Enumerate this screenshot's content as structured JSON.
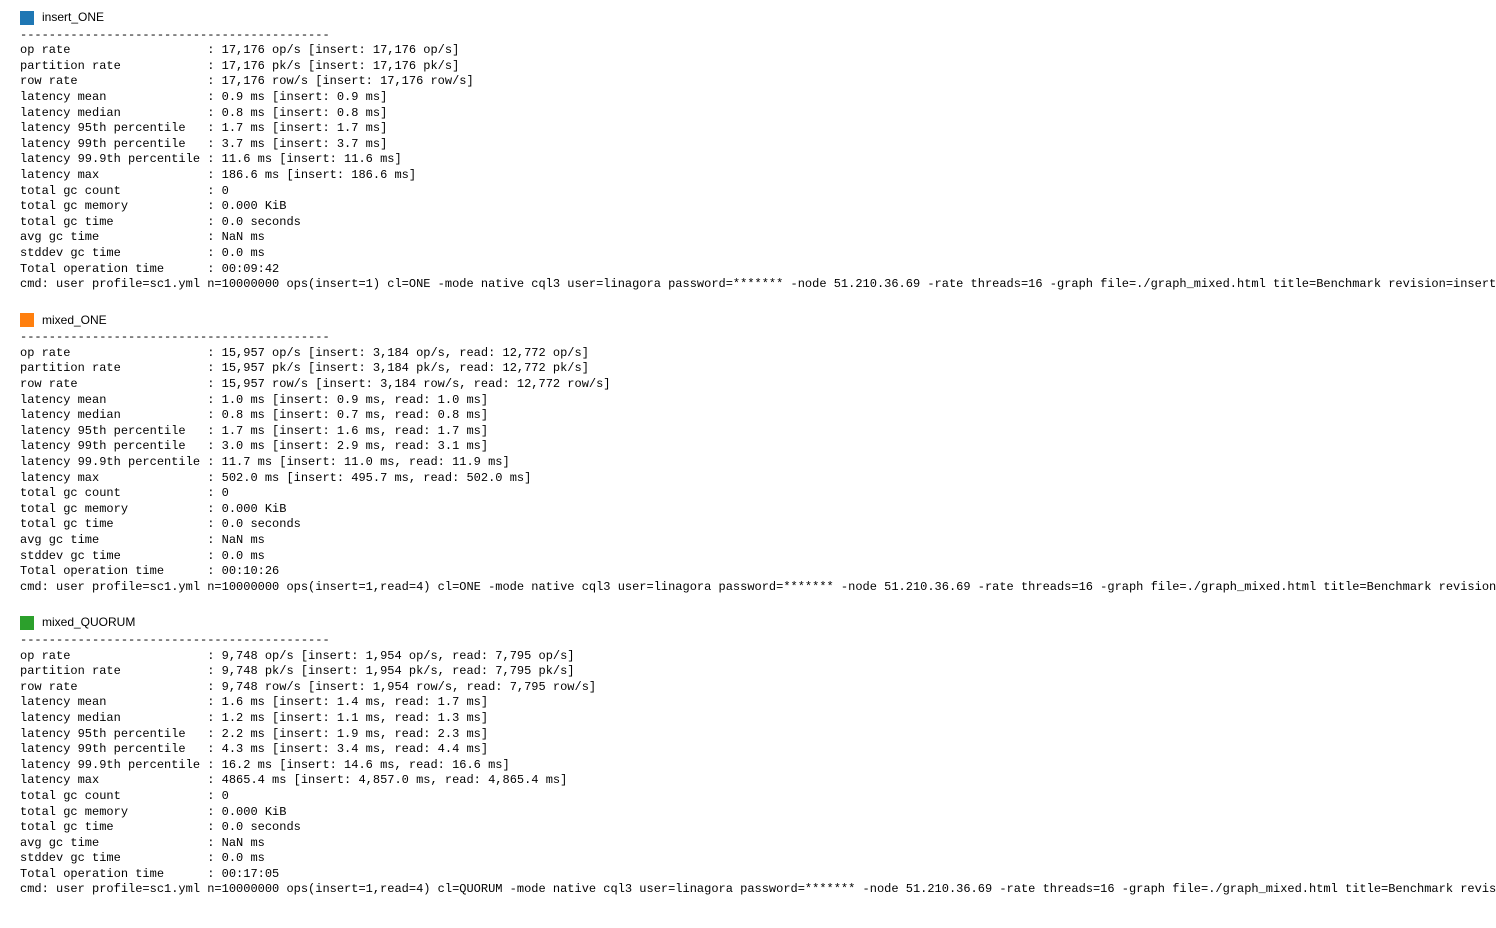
{
  "sections": [
    {
      "color": "#1f77b4",
      "name": "insert_ONE",
      "dashes": "-------------------------------------------",
      "metrics": [
        {
          "label": "op rate",
          "value": "17,176 op/s [insert: 17,176 op/s]"
        },
        {
          "label": "partition rate",
          "value": "17,176 pk/s [insert: 17,176 pk/s]"
        },
        {
          "label": "row rate",
          "value": "17,176 row/s [insert: 17,176 row/s]"
        },
        {
          "label": "latency mean",
          "value": "0.9 ms [insert: 0.9 ms]"
        },
        {
          "label": "latency median",
          "value": "0.8 ms [insert: 0.8 ms]"
        },
        {
          "label": "latency 95th percentile",
          "value": "1.7 ms [insert: 1.7 ms]"
        },
        {
          "label": "latency 99th percentile",
          "value": "3.7 ms [insert: 3.7 ms]"
        },
        {
          "label": "latency 99.9th percentile",
          "value": "11.6 ms [insert: 11.6 ms]"
        },
        {
          "label": "latency max",
          "value": "186.6 ms [insert: 186.6 ms]"
        },
        {
          "label": "total gc count",
          "value": "0"
        },
        {
          "label": "total gc memory",
          "value": "0.000 KiB"
        },
        {
          "label": "total gc time",
          "value": "0.0 seconds"
        },
        {
          "label": "avg gc time",
          "value": "NaN ms"
        },
        {
          "label": "stddev gc time",
          "value": "0.0 ms"
        },
        {
          "label": "Total operation time",
          "value": "00:09:42"
        }
      ],
      "cmd": "cmd: user profile=sc1.yml n=10000000 ops(insert=1) cl=ONE -mode native cql3 user=linagora password=******* -node 51.210.36.69 -rate threads=16 -graph file=./graph_mixed.html title=Benchmark revision=insert_ONE"
    },
    {
      "color": "#ff7f0e",
      "name": "mixed_ONE",
      "dashes": "-------------------------------------------",
      "metrics": [
        {
          "label": "op rate",
          "value": "15,957 op/s [insert: 3,184 op/s, read: 12,772 op/s]"
        },
        {
          "label": "partition rate",
          "value": "15,957 pk/s [insert: 3,184 pk/s, read: 12,772 pk/s]"
        },
        {
          "label": "row rate",
          "value": "15,957 row/s [insert: 3,184 row/s, read: 12,772 row/s]"
        },
        {
          "label": "latency mean",
          "value": "1.0 ms [insert: 0.9 ms, read: 1.0 ms]"
        },
        {
          "label": "latency median",
          "value": "0.8 ms [insert: 0.7 ms, read: 0.8 ms]"
        },
        {
          "label": "latency 95th percentile",
          "value": "1.7 ms [insert: 1.6 ms, read: 1.7 ms]"
        },
        {
          "label": "latency 99th percentile",
          "value": "3.0 ms [insert: 2.9 ms, read: 3.1 ms]"
        },
        {
          "label": "latency 99.9th percentile",
          "value": "11.7 ms [insert: 11.0 ms, read: 11.9 ms]"
        },
        {
          "label": "latency max",
          "value": "502.0 ms [insert: 495.7 ms, read: 502.0 ms]"
        },
        {
          "label": "total gc count",
          "value": "0"
        },
        {
          "label": "total gc memory",
          "value": "0.000 KiB"
        },
        {
          "label": "total gc time",
          "value": "0.0 seconds"
        },
        {
          "label": "avg gc time",
          "value": "NaN ms"
        },
        {
          "label": "stddev gc time",
          "value": "0.0 ms"
        },
        {
          "label": "Total operation time",
          "value": "00:10:26"
        }
      ],
      "cmd": "cmd: user profile=sc1.yml n=10000000 ops(insert=1,read=4) cl=ONE -mode native cql3 user=linagora password=******* -node 51.210.36.69 -rate threads=16 -graph file=./graph_mixed.html title=Benchmark revision=mixed_ONE"
    },
    {
      "color": "#2ca02c",
      "name": "mixed_QUORUM",
      "dashes": "-------------------------------------------",
      "metrics": [
        {
          "label": "op rate",
          "value": "9,748 op/s [insert: 1,954 op/s, read: 7,795 op/s]"
        },
        {
          "label": "partition rate",
          "value": "9,748 pk/s [insert: 1,954 pk/s, read: 7,795 pk/s]"
        },
        {
          "label": "row rate",
          "value": "9,748 row/s [insert: 1,954 row/s, read: 7,795 row/s]"
        },
        {
          "label": "latency mean",
          "value": "1.6 ms [insert: 1.4 ms, read: 1.7 ms]"
        },
        {
          "label": "latency median",
          "value": "1.2 ms [insert: 1.1 ms, read: 1.3 ms]"
        },
        {
          "label": "latency 95th percentile",
          "value": "2.2 ms [insert: 1.9 ms, read: 2.3 ms]"
        },
        {
          "label": "latency 99th percentile",
          "value": "4.3 ms [insert: 3.4 ms, read: 4.4 ms]"
        },
        {
          "label": "latency 99.9th percentile",
          "value": "16.2 ms [insert: 14.6 ms, read: 16.6 ms]"
        },
        {
          "label": "latency max",
          "value": "4865.4 ms [insert: 4,857.0 ms, read: 4,865.4 ms]"
        },
        {
          "label": "total gc count",
          "value": "0"
        },
        {
          "label": "total gc memory",
          "value": "0.000 KiB"
        },
        {
          "label": "total gc time",
          "value": "0.0 seconds"
        },
        {
          "label": "avg gc time",
          "value": "NaN ms"
        },
        {
          "label": "stddev gc time",
          "value": "0.0 ms"
        },
        {
          "label": "Total operation time",
          "value": "00:17:05"
        }
      ],
      "cmd": "cmd: user profile=sc1.yml n=10000000 ops(insert=1,read=4) cl=QUORUM -mode native cql3 user=linagora password=******* -node 51.210.36.69 -rate threads=16 -graph file=./graph_mixed.html title=Benchmark revision=mixed_QUORUM"
    }
  ]
}
